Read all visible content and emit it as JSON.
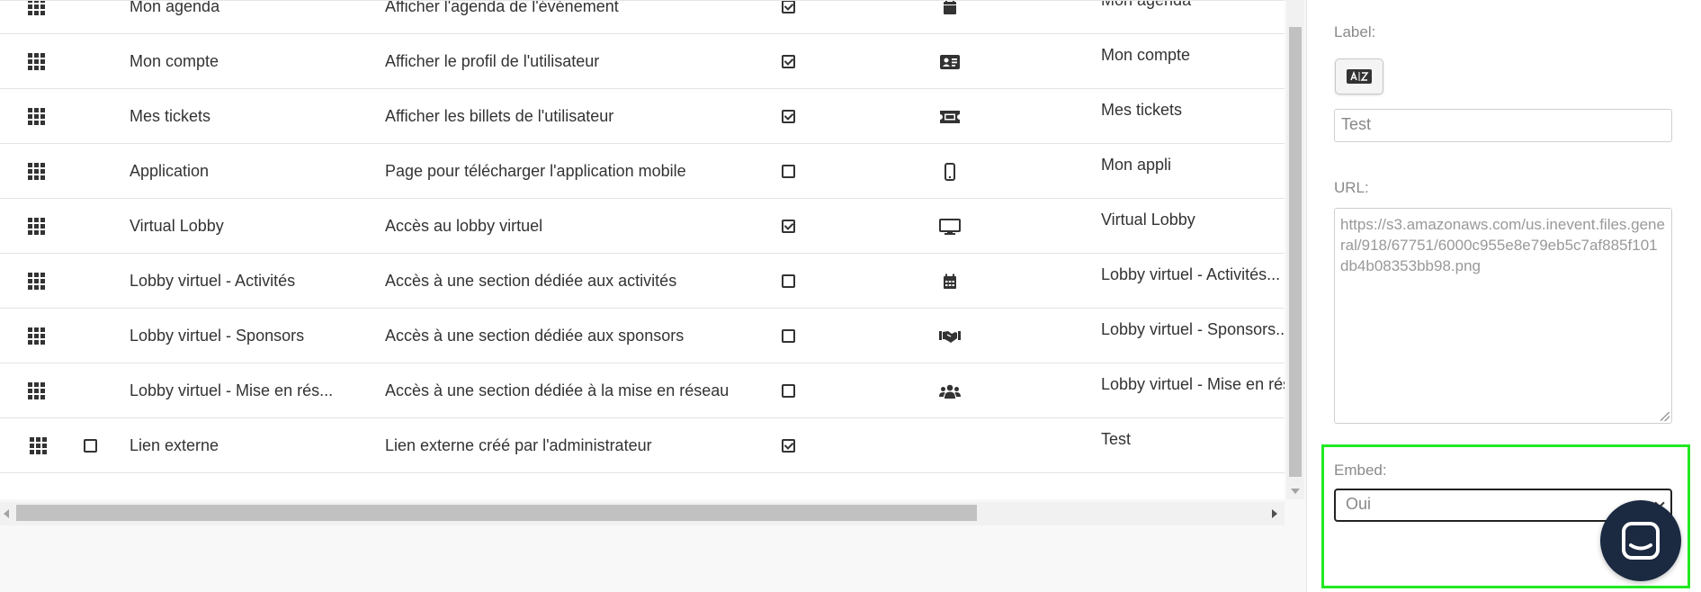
{
  "table": {
    "rows": [
      {
        "name": "Mon agenda",
        "desc": "Afficher l'agenda de l'événement",
        "checked": true,
        "icon": "calendar-icon",
        "label": "Mon agenda",
        "row_checkbox": false
      },
      {
        "name": "Mon compte",
        "desc": "Afficher le profil de l'utilisateur",
        "checked": true,
        "icon": "id-card-icon",
        "label": "Mon compte",
        "row_checkbox": false
      },
      {
        "name": "Mes tickets",
        "desc": "Afficher les billets de l'utilisateur",
        "checked": true,
        "icon": "ticket-icon",
        "label": "Mes tickets",
        "row_checkbox": false
      },
      {
        "name": "Application",
        "desc": "Page pour télécharger l'application mobile",
        "checked": false,
        "icon": "mobile-phone-icon",
        "label": "Mon appli",
        "row_checkbox": false
      },
      {
        "name": "Virtual Lobby",
        "desc": "Accès au lobby virtuel",
        "checked": true,
        "icon": "desktop-icon",
        "label": "Virtual Lobby",
        "row_checkbox": false
      },
      {
        "name": "Lobby virtuel - Activités",
        "desc": "Accès à une section dédiée aux activités",
        "checked": false,
        "icon": "calendar-icon",
        "label": "Lobby virtuel - Activités...",
        "row_checkbox": false
      },
      {
        "name": "Lobby virtuel - Sponsors",
        "desc": "Accès à une section dédiée aux sponsors",
        "checked": false,
        "icon": "handshake-icon",
        "label": "Lobby virtuel - Sponsors...",
        "row_checkbox": false
      },
      {
        "name": "Lobby virtuel - Mise en rés...",
        "desc": "Accès à une section dédiée à la mise en réseau",
        "checked": false,
        "icon": "users-icon",
        "label": "Lobby virtuel - Mise en rés",
        "row_checkbox": false
      },
      {
        "name": "Lien externe",
        "desc": "Lien externe créé par l'administrateur",
        "checked": true,
        "icon": "",
        "label": "Test",
        "row_checkbox": true
      }
    ]
  },
  "panel": {
    "label_title": "Label:",
    "label_value": "Test",
    "url_title": "URL:",
    "url_value": "https://s3.amazonaws.com/us.inevent.files.general/918/67751/6000c955e8e79eb5c7af885f101db4b08353bb98.png",
    "embed_title": "Embed:",
    "embed_value": "Oui",
    "highlight_color": "#22e822"
  },
  "chat": {
    "icon": "chat-widget-icon",
    "color": "#1b2a41"
  }
}
